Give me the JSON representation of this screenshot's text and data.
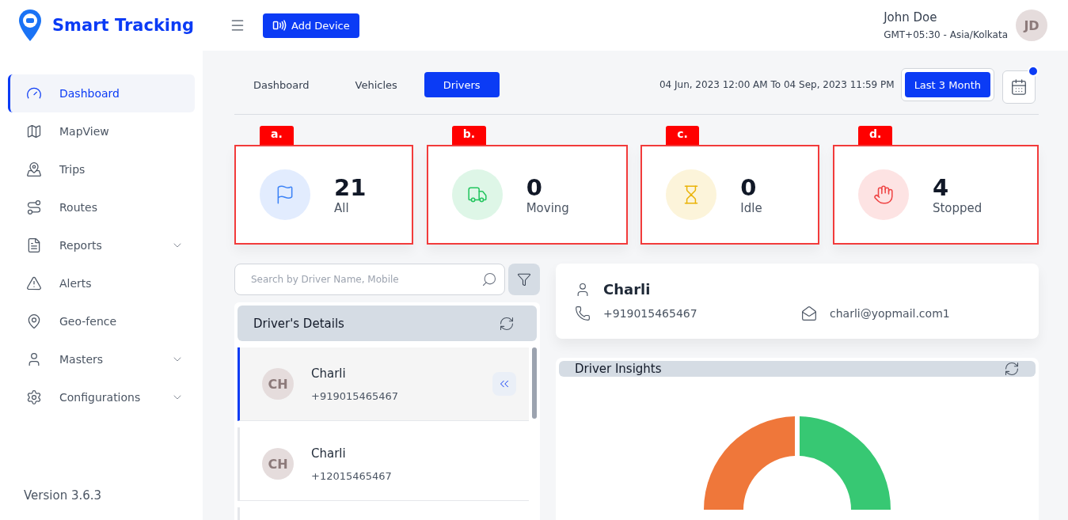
{
  "brand": {
    "name": "Smart Tracking"
  },
  "header": {
    "add_button": "Add Device",
    "user_name": "John Doe",
    "timezone": "GMT+05:30 - Asia/Kolkata",
    "avatar_initials": "JD"
  },
  "sidebar": {
    "items": [
      {
        "label": "Dashboard",
        "selected": true,
        "has_submenu": false
      },
      {
        "label": "MapView",
        "selected": false,
        "has_submenu": false
      },
      {
        "label": "Trips",
        "selected": false,
        "has_submenu": false
      },
      {
        "label": "Routes",
        "selected": false,
        "has_submenu": false
      },
      {
        "label": "Reports",
        "selected": false,
        "has_submenu": true
      },
      {
        "label": "Alerts",
        "selected": false,
        "has_submenu": false
      },
      {
        "label": "Geo-fence",
        "selected": false,
        "has_submenu": false
      },
      {
        "label": "Masters",
        "selected": false,
        "has_submenu": true
      },
      {
        "label": "Configurations",
        "selected": false,
        "has_submenu": true
      }
    ],
    "version": "Version 3.6.3"
  },
  "tabs": [
    {
      "label": "Dashboard",
      "selected": false
    },
    {
      "label": "Vehicles",
      "selected": false
    },
    {
      "label": "Drivers",
      "selected": true
    }
  ],
  "date_range": "04 Jun, 2023 12:00 AM To 04 Sep, 2023 11:59 PM",
  "range_button": "Last 3 Month",
  "stats": [
    {
      "tag": "a.",
      "value": "21",
      "label": "All",
      "color": "#3b82f6"
    },
    {
      "tag": "b.",
      "value": "0",
      "label": "Moving",
      "color": "#22c55e"
    },
    {
      "tag": "c.",
      "value": "0",
      "label": "Idle",
      "color": "#eab308"
    },
    {
      "tag": "d.",
      "value": "4",
      "label": "Stopped",
      "color": "#ef4444"
    }
  ],
  "search": {
    "placeholder": "Search by Driver Name, Mobile"
  },
  "drivers_panel": {
    "title": "Driver's Details",
    "drivers": [
      {
        "initials": "CH",
        "name": "Charli",
        "phone": "+919015465467",
        "selected": true
      },
      {
        "initials": "CH",
        "name": "Charli",
        "phone": "+12015465467",
        "selected": false
      }
    ]
  },
  "driver_card": {
    "name": "Charli",
    "phone": "+919015465467",
    "email": "charli@yopmail.com1"
  },
  "insights": {
    "title": "Driver Insights"
  }
}
